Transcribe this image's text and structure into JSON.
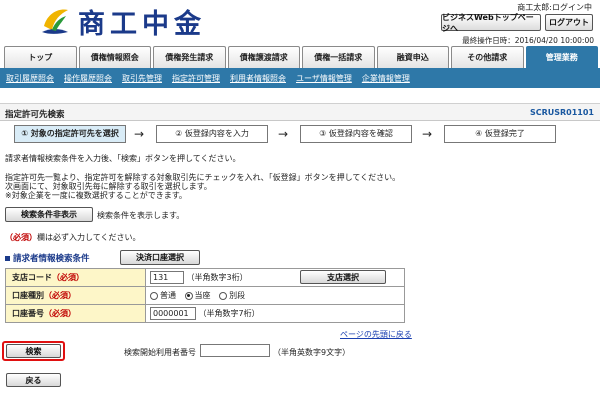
{
  "header": {
    "logo_text": "商工中金",
    "user": "商工太郎:ログイン中",
    "business_top_label": "ビジネスWebトップページへ",
    "logout_label": "ログアウト",
    "last_operation": "最終操作日時：2016/04/20 10:00:00"
  },
  "tabs": [
    "トップ",
    "債権情報照会",
    "債権発生請求",
    "債権譲渡請求",
    "債権一括請求",
    "融資申込",
    "その他請求",
    "管理業務"
  ],
  "subnav": [
    "取引履歴照会",
    "操作履歴照会",
    "取引先管理",
    "指定許可管理",
    "利用者情報照会",
    "ユーザ情報管理",
    "企業情報管理"
  ],
  "page": {
    "title": "指定許可先検索",
    "screen_id": "SCRUSR01101"
  },
  "steps": [
    "① 対象の指定許可先を選択",
    "② 仮登録内容を入力",
    "③ 仮登録内容を確認",
    "④ 仮登録完了"
  ],
  "instructions": {
    "line1": "請求者情報検索条件を入力後、「検索」ボタンを押してください。",
    "line2": "指定許可先一覧より、指定許可を解除する対象取引先にチェックを入れ、「仮登録」ボタンを押してください。",
    "line3": "次画面にて、対象取引先毎に解除する取引を選択します。",
    "line4": "※対象企業を一度に複数選択することができます。"
  },
  "search_toggle": {
    "button_label": "検索条件非表示",
    "description": "検索条件を表示します。"
  },
  "required_note": {
    "mark": "（必須）",
    "text": "欄は必ず入力してください。"
  },
  "search_section": {
    "title": "請求者情報検索条件",
    "settlement_button_label": "決済口座選択",
    "branch_code": {
      "label": "支店コード",
      "required": "（必須）",
      "value": "131",
      "hint": "（半角数字3桁）",
      "button_label": "支店選択"
    },
    "account_type": {
      "label": "口座種別",
      "required": "（必須）",
      "options": [
        "普通",
        "当座",
        "別段"
      ],
      "selected": "当座"
    },
    "account_number": {
      "label": "口座番号",
      "required": "（必須）",
      "value": "0000001",
      "hint": "（半角数字7桁）"
    }
  },
  "links": {
    "page_top": "ページの先頭に戻る"
  },
  "actions": {
    "search_label": "検索",
    "user_number_label": "検索開始利用者番号",
    "user_number_value": "",
    "user_number_hint": "（半角英数字9文字）",
    "back_label": "戻る"
  },
  "colors": {
    "brand": "#1b3a8a",
    "nav": "#2e78a8",
    "required": "#c00000",
    "highlight": "#e01010"
  }
}
